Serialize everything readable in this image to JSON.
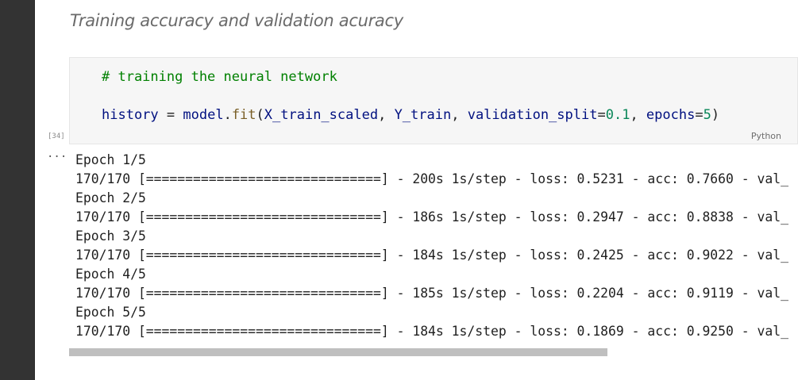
{
  "markdown": {
    "heading": "Training accuracy and validation acuracy"
  },
  "code_cell": {
    "comment": "# training the neural network",
    "code": {
      "var": "history",
      "eq": " = ",
      "obj": "model",
      "dot": ".",
      "fn": "fit",
      "open": "(",
      "arg1": "X_train_scaled",
      "comma1": ", ",
      "arg2": "Y_train",
      "comma2": ", ",
      "kw1": "validation_split",
      "eq2": "=",
      "val1": "0.1",
      "comma3": ", ",
      "kw2": "epochs",
      "eq3": "=",
      "val2": "5",
      "close": ")"
    },
    "language": "Python",
    "execution_count": "[34]"
  },
  "output": {
    "toggle": "···",
    "lines": [
      "Epoch 1/5",
      "170/170 [==============================] - 200s 1s/step - loss: 0.5231 - acc: 0.7660 - val_",
      "Epoch 2/5",
      "170/170 [==============================] - 186s 1s/step - loss: 0.2947 - acc: 0.8838 - val_",
      "Epoch 3/5",
      "170/170 [==============================] - 184s 1s/step - loss: 0.2425 - acc: 0.9022 - val_",
      "Epoch 4/5",
      "170/170 [==============================] - 185s 1s/step - loss: 0.2204 - acc: 0.9119 - val_",
      "Epoch 5/5",
      "170/170 [==============================] - 184s 1s/step - loss: 0.1869 - acc: 0.9250 - val_"
    ]
  },
  "colors": {
    "comment": "#008000",
    "variable": "#001080",
    "function": "#795e26",
    "number": "#098658",
    "sidebar": "#333333"
  }
}
